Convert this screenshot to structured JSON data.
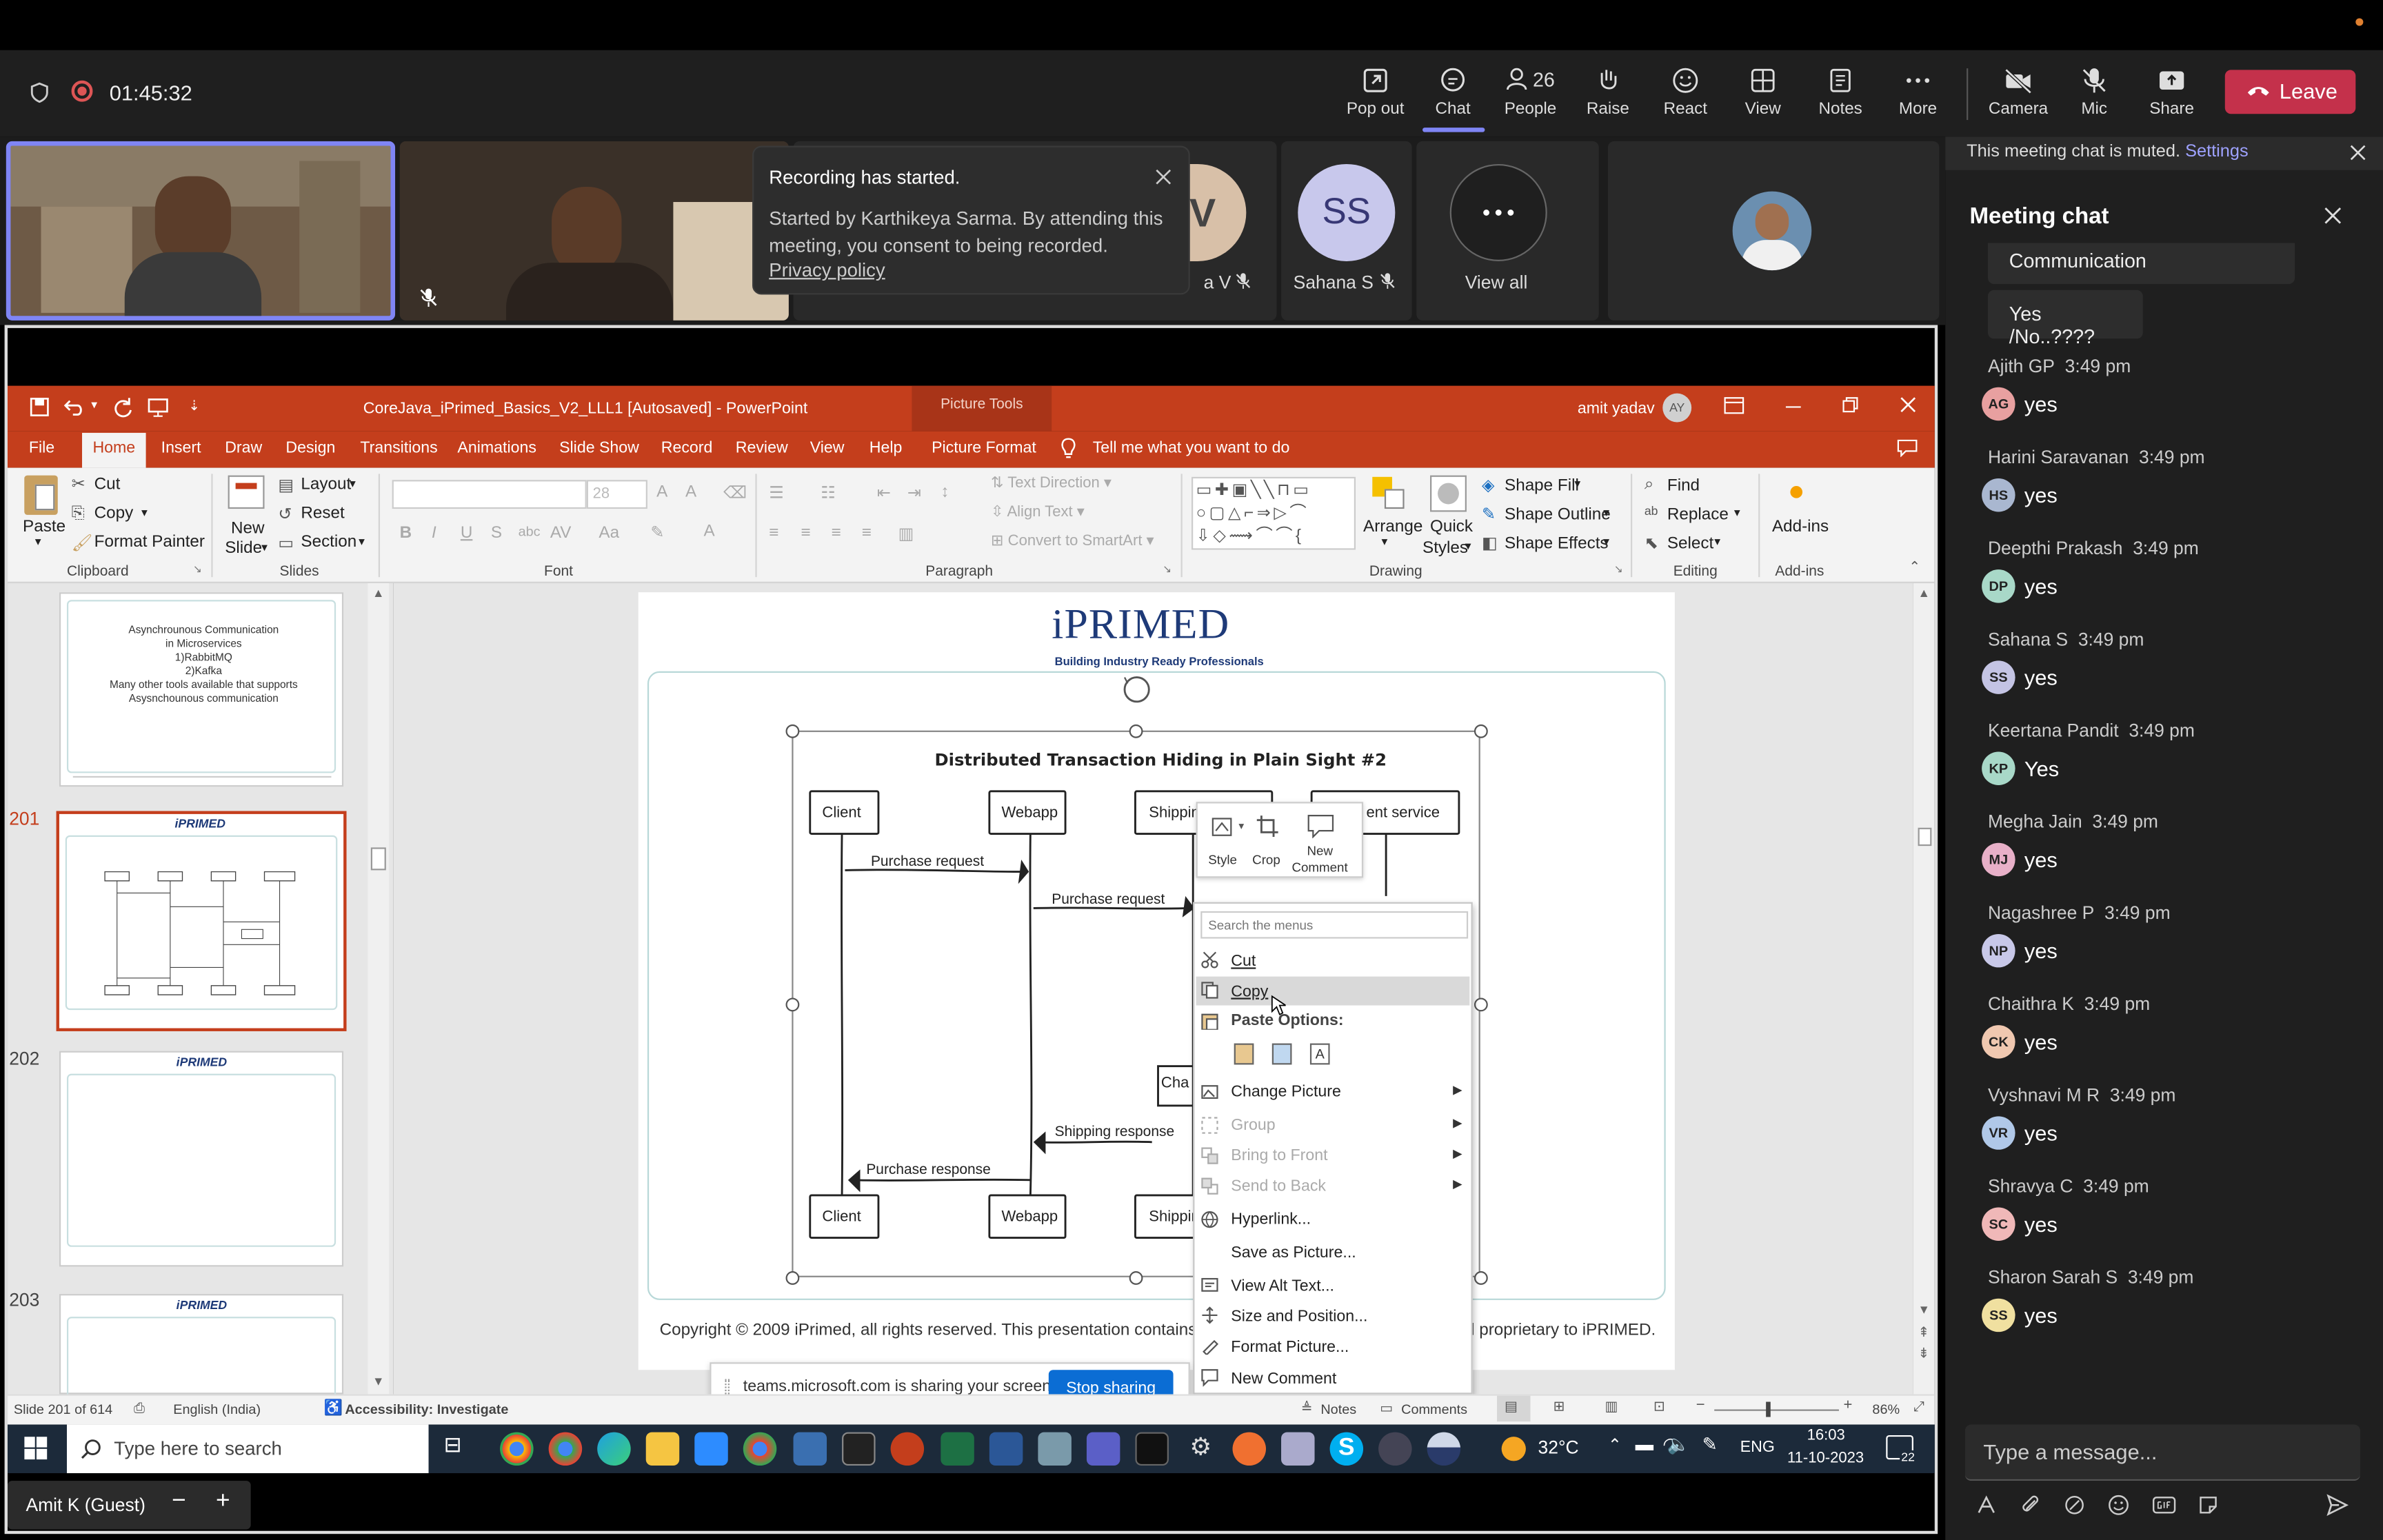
{
  "teams": {
    "timer": "01:45:32",
    "buttons": [
      "Pop out",
      "Chat",
      "People",
      "Raise",
      "React",
      "View",
      "Notes",
      "More",
      "Camera",
      "Mic",
      "Share"
    ],
    "people_count": "26",
    "leave": "Leave"
  },
  "toast": {
    "title": "Recording has started.",
    "body": "Started by Karthikeya Sarma. By attending this meeting, you consent to being recorded.",
    "link": "Privacy policy"
  },
  "participants": {
    "partial_name": "a V",
    "ss_initials": "SS",
    "ss_name": "Sahana S",
    "view_all": "View all",
    "partial_initials": "V"
  },
  "muted_banner": {
    "text": "This meeting chat is muted.",
    "link": "Settings"
  },
  "chat": {
    "title": "Meeting chat",
    "prev1": "Communication",
    "prev2": "Yes /No..????",
    "messages": [
      {
        "name": "Ajith GP",
        "time": "3:49 pm",
        "initials": "AG",
        "text": "yes",
        "color": "#e8a0a0"
      },
      {
        "name": "Harini Saravanan",
        "time": "3:49 pm",
        "initials": "HS",
        "text": "yes",
        "color": "#a9b7d0"
      },
      {
        "name": "Deepthi Prakash",
        "time": "3:49 pm",
        "initials": "DP",
        "text": "yes",
        "color": "#a8d8c8"
      },
      {
        "name": "Sahana S",
        "time": "3:49 pm",
        "initials": "SS",
        "text": "yes",
        "color": "#c4c4e4"
      },
      {
        "name": "Keertana Pandit",
        "time": "3:49 pm",
        "initials": "KP",
        "text": "Yes",
        "color": "#a8d8c8"
      },
      {
        "name": "Megha Jain",
        "time": "3:49 pm",
        "initials": "MJ",
        "text": "yes",
        "color": "#e8b0c8"
      },
      {
        "name": "Nagashree P",
        "time": "3:49 pm",
        "initials": "NP",
        "text": "yes",
        "color": "#c8c8e8"
      },
      {
        "name": "Chaithra K",
        "time": "3:49 pm",
        "initials": "CK",
        "text": "yes",
        "color": "#f0c8b0"
      },
      {
        "name": "Vyshnavi M R",
        "time": "3:49 pm",
        "initials": "VR",
        "text": "yes",
        "color": "#b0c8e8"
      },
      {
        "name": "Shravya C",
        "time": "3:49 pm",
        "initials": "SC",
        "text": "yes",
        "color": "#f0b8b8"
      },
      {
        "name": "Sharon Sarah S",
        "time": "3:49 pm",
        "initials": "SS",
        "text": "yes",
        "color": "#f0e0a0"
      }
    ],
    "placeholder": "Type a message..."
  },
  "ppt": {
    "title": "CoreJava_iPrimed_Basics_V2_LLL1 [Autosaved] - PowerPoint",
    "picture_tools": "Picture Tools",
    "user": "amit yadav",
    "user_initials": "AY",
    "tabs": [
      "File",
      "Home",
      "Insert",
      "Draw",
      "Design",
      "Transitions",
      "Animations",
      "Slide Show",
      "Record",
      "Review",
      "View",
      "Help",
      "Picture Format"
    ],
    "tell_me": "Tell me what you want to do",
    "ribbon": {
      "cut": "Cut",
      "copy": "Copy",
      "paste": "Paste",
      "format_painter": "Format Painter",
      "clipboard": "Clipboard",
      "new": "New",
      "slide": "Slide",
      "layout": "Layout",
      "reset": "Reset",
      "section": "Section",
      "slides": "Slides",
      "font_size": "28",
      "font": "Font",
      "text_direction": "Text Direction",
      "align_text": "Align Text",
      "convert_smartart": "Convert to SmartArt",
      "paragraph": "Paragraph",
      "arrange": "Arrange",
      "quick": "Quick",
      "styles": "Styles",
      "shape_fill": "Shape Fill",
      "shape_outline": "Shape Outline",
      "shape_effects": "Shape Effects",
      "drawing": "Drawing",
      "find": "Find",
      "replace": "Replace",
      "select": "Select",
      "editing": "Editing",
      "addins": "Add-ins",
      "addins_group": "Add-ins"
    },
    "thumbs": {
      "t1_text": [
        "Asynchrounous Communication",
        "in Microservices",
        "1)RabbitMQ",
        "2)Kafka",
        "Many other tools available that supports",
        "Asysnchounous communication"
      ],
      "n201": "201",
      "n202": "202",
      "n203": "203",
      "logo": "iPRIMED"
    },
    "slide": {
      "logo": "iPRIMED",
      "tagline": "Building Industry Ready Professionals",
      "diagram_title": "Distributed Transaction Hiding in Plain Sight #2",
      "client": "Client",
      "webapp": "Webapp",
      "shipping": "Shippin",
      "payment": "ent service",
      "purchase_request": "Purchase request",
      "shipping_response": "Shipping response",
      "purchase_response": "Purchase response",
      "cha": "Cha",
      "copyright": "Copyright © 2009 iPrimed, all rights reserved. This presentation contains info",
      "copyright_end": "nd proprietary to iPRIMED."
    },
    "mini_toolbar": {
      "style": "Style",
      "crop": "Crop",
      "new_comment_1": "New",
      "new_comment_2": "Comment"
    },
    "context_menu": {
      "search": "Search the menus",
      "cut": "Cut",
      "copy": "Copy",
      "paste_options": "Paste Options:",
      "change_picture": "Change Picture",
      "group": "Group",
      "bring_front": "Bring to Front",
      "send_back": "Send to Back",
      "hyperlink": "Hyperlink...",
      "save_as": "Save as Picture...",
      "alt_text": "View Alt Text...",
      "size_pos": "Size and Position...",
      "format_picture": "Format Picture...",
      "new_comment": "New Comment"
    },
    "status": {
      "slide": "Slide 201 of 614",
      "lang": "English (India)",
      "access": "Accessibility: Investigate",
      "notes": "Notes",
      "comments": "Comments",
      "zoom": "86%"
    },
    "share_bar": {
      "text": "teams.microsoft.com is sharing your screen.",
      "stop": "Stop sharing"
    }
  },
  "taskbar": {
    "search": "Type here to search",
    "temp": "32°C",
    "lang": "ENG",
    "time": "16:03",
    "date": "11-10-2023",
    "notif": "22"
  },
  "guest": {
    "name": "Amit K (Guest)"
  }
}
